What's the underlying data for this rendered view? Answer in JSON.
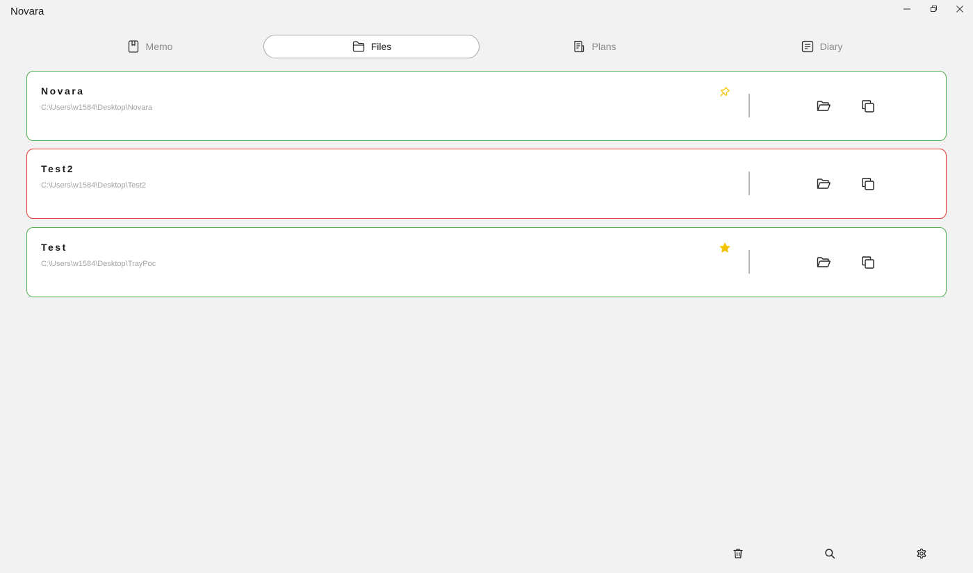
{
  "window": {
    "title": "Novara",
    "icons": {
      "minimize": "minimize-icon",
      "maximize": "restore-icon",
      "close": "close-icon"
    }
  },
  "tabs": [
    {
      "label": "Memo",
      "icon": "memo-icon",
      "active": false
    },
    {
      "label": "Files",
      "icon": "folder-icon",
      "active": true
    },
    {
      "label": "Plans",
      "icon": "plans-icon",
      "active": false
    },
    {
      "label": "Diary",
      "icon": "diary-icon",
      "active": false
    }
  ],
  "cards": [
    {
      "name": "Novara",
      "path": "C:\\Users\\w1584\\Desktop\\Novara",
      "status_color": "#4caf50",
      "badge": "pin-icon"
    },
    {
      "name": "Test2",
      "path": "C:\\Users\\w1584\\Desktop\\Test2",
      "status_color": "#e53935",
      "badge": ""
    },
    {
      "name": "Test",
      "path": "C:\\Users\\w1584\\Desktop\\TrayPoc",
      "status_color": "#4caf50",
      "badge": "star-icon"
    }
  ],
  "card_actions": {
    "open": "folder-open-icon",
    "copy": "copy-icon"
  },
  "bottom_bar": {
    "icons": [
      "trash-icon",
      "search-icon",
      "settings-icon"
    ]
  },
  "colors": {
    "background": "#f2f2f2",
    "card_ok": "#4caf50",
    "card_error": "#e53935",
    "badge": "#f5c400",
    "muted_text": "#a3a3a3"
  }
}
